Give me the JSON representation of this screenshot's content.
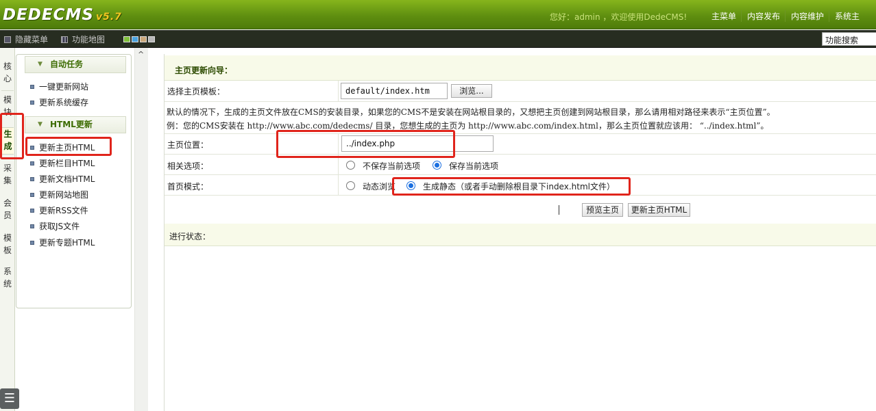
{
  "header": {
    "logo": "DEDECMS",
    "version": "v5.7",
    "greeting": "您好：admin ，欢迎使用DedeCMS!",
    "nav": [
      "主菜单",
      "内容发布",
      "内容维护",
      "系统主"
    ]
  },
  "toolbar": {
    "hide_menu": "隐藏菜单",
    "func_map": "功能地图",
    "search_placeholder": "功能搜索",
    "swatch_colors": [
      "#7fbf3a",
      "#4aa3df",
      "#c9a77a",
      "#b8b8b8"
    ]
  },
  "vtabs": [
    {
      "label": "核心",
      "active": false
    },
    {
      "label": "模块",
      "active": false
    },
    {
      "label": "生成",
      "active": true
    },
    {
      "label": "采集",
      "active": false
    },
    {
      "label": "会员",
      "active": false
    },
    {
      "label": "模板",
      "active": false
    },
    {
      "label": "系统",
      "active": false
    }
  ],
  "menu": {
    "groups": [
      {
        "title": "自动任务",
        "items": [
          "一键更新网站",
          "更新系统缓存"
        ]
      },
      {
        "title": "HTML更新",
        "items": [
          "更新主页HTML",
          "更新栏目HTML",
          "更新文档HTML",
          "更新网站地图",
          "更新RSS文件",
          "获取JS文件",
          "更新专题HTML"
        ]
      }
    ]
  },
  "form": {
    "title": "主页更新向导：",
    "template_label": "选择主页模板：",
    "template_value": "default/index.htm",
    "browse_label": "浏览...",
    "note1": "默认的情况下，生成的主页文件放在CMS的安装目录，如果您的CMS不是安装在网站根目录的，又想把主页创建到网站根目录，那么请用相对路径来表示“主页位置”。",
    "note2": "例：您的CMS安装在 http://www.abc.com/dedecms/ 目录，您想生成的主页为 http://www.abc.com/index.html，那么主页位置就应该用： “../index.html”。",
    "position_label": "主页位置：",
    "position_value": "../index.php",
    "options_label": "相关选项：",
    "option_no_save": "不保存当前选项",
    "option_save": "保存当前选项",
    "mode_label": "首页模式：",
    "mode_dynamic": "动态浏览",
    "mode_static": "生成静态（或者手动删除根目录下index.html文件）",
    "preview_button": "预览主页",
    "update_button": "更新主页HTML",
    "status_label": "进行状态："
  }
}
